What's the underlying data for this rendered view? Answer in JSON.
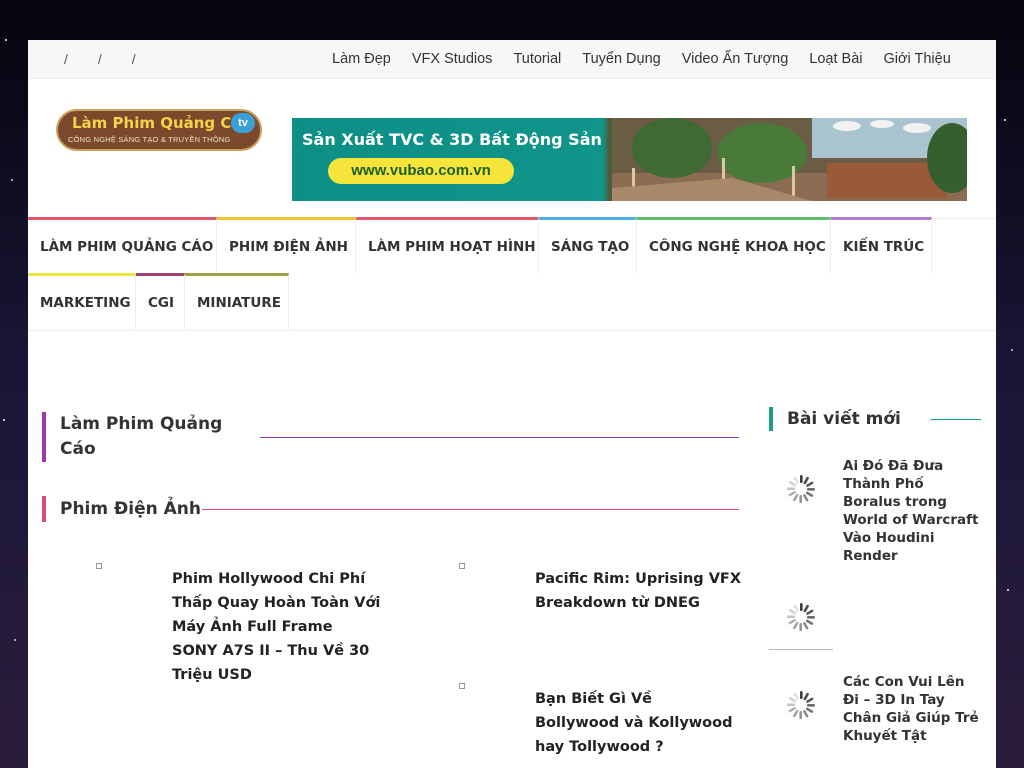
{
  "topbar": {
    "slashes": [
      "/",
      "/",
      "/"
    ],
    "links": [
      "Làm Đẹp",
      "VFX Studios",
      "Tutorial",
      "Tuyển Dụng",
      "Video Ấn Tượng",
      "Loạt Bài",
      "Giới Thiệu"
    ]
  },
  "logo": {
    "main": "Làm Phim Quảng Cáo",
    "badge": "tv",
    "sub": "CÔNG NGHỆ SÁNG TẠO & TRUYỀN THÔNG"
  },
  "banner": {
    "title": "Sản Xuất TVC & 3D Bất Động Sản",
    "url": "www.vubao.com.vn"
  },
  "mainnav": {
    "row1": [
      {
        "label": "LÀM PHIM QUẢNG CÁO",
        "color": "#e05a6a"
      },
      {
        "label": "PHIM ĐIỆN ẢNH",
        "color": "#f1c232"
      },
      {
        "label": "LÀM PHIM HOẠT HÌNH",
        "color": "#e05a6a"
      },
      {
        "label": "SÁNG TẠO",
        "color": "#4ab0e6"
      },
      {
        "label": "CÔNG NGHỆ KHOA HỌC",
        "color": "#5fbf6a"
      },
      {
        "label": "KIẾN TRÚC",
        "color": "#b07ad3"
      }
    ],
    "row2": [
      {
        "label": "MARKETING",
        "color": "#e8e845"
      },
      {
        "label": "CGI",
        "color": "#a04070"
      },
      {
        "label": "MINIATURE",
        "color": "#a0a040"
      }
    ]
  },
  "sections": [
    {
      "title": "Làm Phim Quảng Cáo",
      "color": "#9b39b5"
    },
    {
      "title": "Phim Điện Ảnh",
      "color": "#d9497a"
    }
  ],
  "posts": [
    {
      "title": "Phim Hollywood Chi Phí Thấp Quay Hoàn Toàn Với Máy Ảnh Full Frame SONY A7S II – Thu Về 30 Triệu USD"
    },
    {
      "title": "Pacific Rim: Uprising VFX Breakdown từ DNEG"
    },
    {
      "title": "Bạn Biết Gì Về Bollywood và Kollywood hay Tollywood ?"
    }
  ],
  "sidebar": {
    "title": "Bài viết mới",
    "accent": "#1a9e8a",
    "posts": [
      {
        "title": "Ai Đó Đã Đưa Thành Phố Boralus trong World of Warcraft Vào Houdini Render"
      },
      {
        "title": ""
      },
      {
        "title": "Các Con Vui Lên Đi – 3D In Tay Chân Giả Giúp Trẻ Khuyết Tật"
      }
    ]
  },
  "icons": {
    "loading": "spinner-icon",
    "bullet": "bullet-icon"
  }
}
